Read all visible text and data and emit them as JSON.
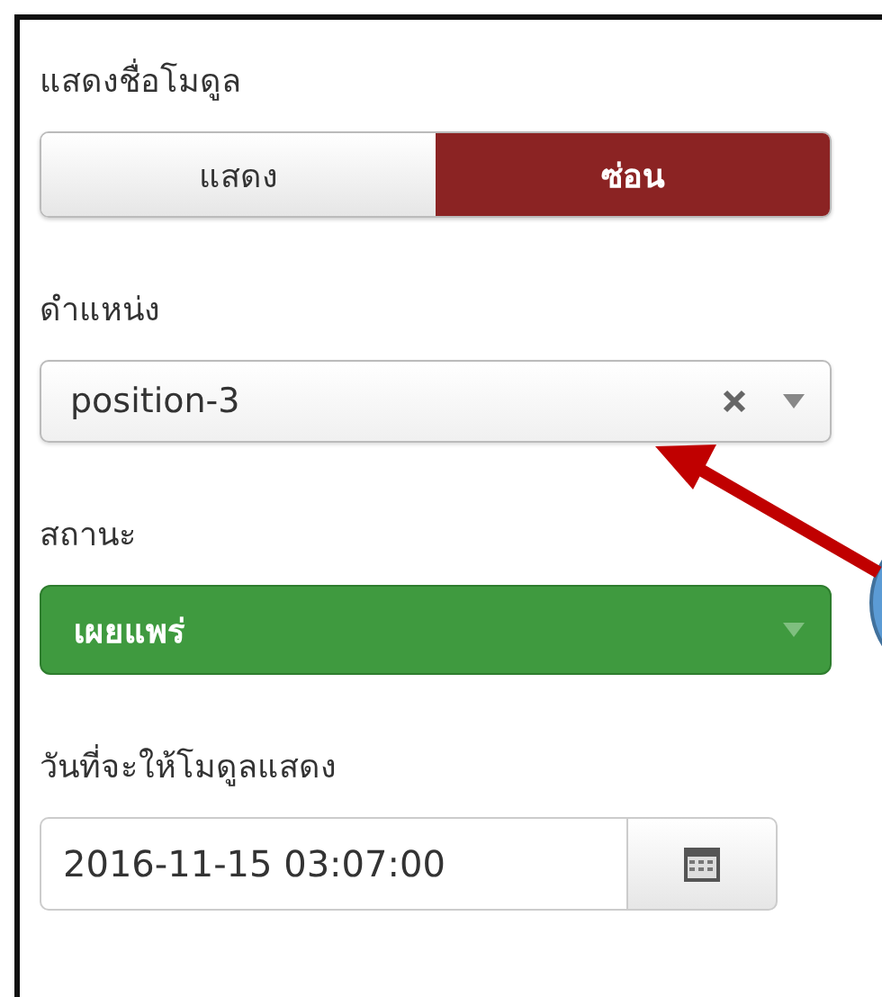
{
  "fields": [
    {
      "kind": "toggle",
      "label": "แสดงชื่อโมดูล",
      "options": [
        {
          "label": "แสดง",
          "selected": false
        },
        {
          "label": "ซ่อน",
          "selected": true
        }
      ]
    },
    {
      "kind": "select",
      "label": "ดำแหน่ง",
      "value": "position-3",
      "clearable": true
    },
    {
      "kind": "status",
      "label": "สถานะ",
      "value": "เผยแพร่"
    },
    {
      "kind": "date",
      "label": "วันที่จะให้โมดูลแสดง",
      "value": "2016-11-15 03:07:00"
    }
  ]
}
